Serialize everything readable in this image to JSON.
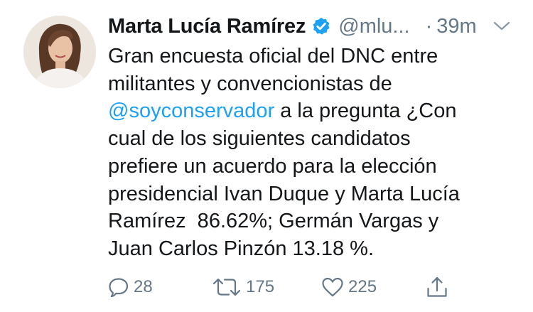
{
  "tweet": {
    "author_name": "Marta Lucía Ramírez",
    "handle": "@mlu...",
    "dot": "·",
    "time": "39m",
    "text_lines": [
      [
        {
          "text": "Gran encuesta oficial del DNC entre"
        }
      ],
      [
        {
          "text": "militantes y convencionistas de"
        }
      ],
      [
        {
          "text": "@soyconservador",
          "mention": true
        },
        {
          "text": " a la pregunta ¿Con"
        }
      ],
      [
        {
          "text": "cual de los siguientes candidatos"
        }
      ],
      [
        {
          "text": "prefiere un acuerdo para la elección"
        }
      ],
      [
        {
          "text": "presidencial Ivan Duque y Marta Lucía"
        }
      ],
      [
        {
          "text": "Ramírez  86.62%; Germán Vargas y"
        }
      ],
      [
        {
          "text": "Juan Carlos Pinzón 13.18 %."
        }
      ]
    ],
    "actions": {
      "reply_count": "28",
      "retweet_count": "175",
      "like_count": "225"
    }
  },
  "icons": {
    "avatar": "avatar-photo",
    "verified": "verified-badge-icon",
    "caret": "chevron-down-icon",
    "reply": "reply-icon",
    "retweet": "retweet-icon",
    "like": "heart-icon",
    "share": "share-icon"
  },
  "colors": {
    "text": "#14171a",
    "muted": "#657786",
    "link": "#1da1f2",
    "verified": "#1da1f2",
    "background": "#ffffff"
  }
}
